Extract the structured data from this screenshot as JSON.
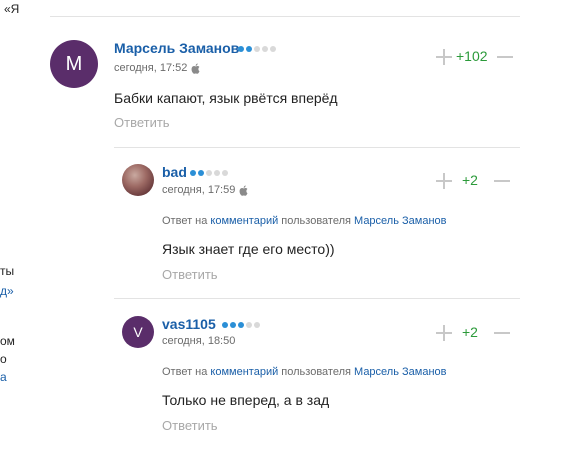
{
  "colors": {
    "link_blue": "#1a5fa8",
    "score_green": "#2b9a3a",
    "rating_blue": "#2b8fd6",
    "muted_gray": "#a8a8a8",
    "avatar_purple": "#5a2d6a"
  },
  "left_fragments": {
    "top": "«Я",
    "f1": "ты",
    "f2": "д»",
    "f3": "ом",
    "f4": "о",
    "f5": "а"
  },
  "comments": [
    {
      "author": "Марсель Заманов",
      "avatar_letter": "М",
      "rating_level": 2,
      "time": "сегодня, 17:52",
      "device_icon": "apple-icon",
      "text": "Бабки капают, язык рвётся вперёд",
      "reply_label": "Ответить",
      "score": "+102"
    },
    {
      "author": "bad",
      "avatar_letter": "",
      "rating_level": 2,
      "time": "сегодня, 17:59",
      "device_icon": "apple-icon",
      "reply_to": {
        "prefix": "Ответ на",
        "link": "комментарий",
        "middle": "пользователя",
        "user": "Марсель Заманов"
      },
      "text": "Язык знает где его место))",
      "reply_label": "Ответить",
      "score": "+2"
    },
    {
      "author": "vas1105",
      "avatar_letter": "V",
      "rating_level": 3,
      "time": "сегодня, 18:50",
      "reply_to": {
        "prefix": "Ответ на",
        "link": "комментарий",
        "middle": "пользователя",
        "user": "Марсель Заманов"
      },
      "text": "Только не вперед, а в зад",
      "reply_label": "Ответить",
      "score": "+2"
    }
  ]
}
